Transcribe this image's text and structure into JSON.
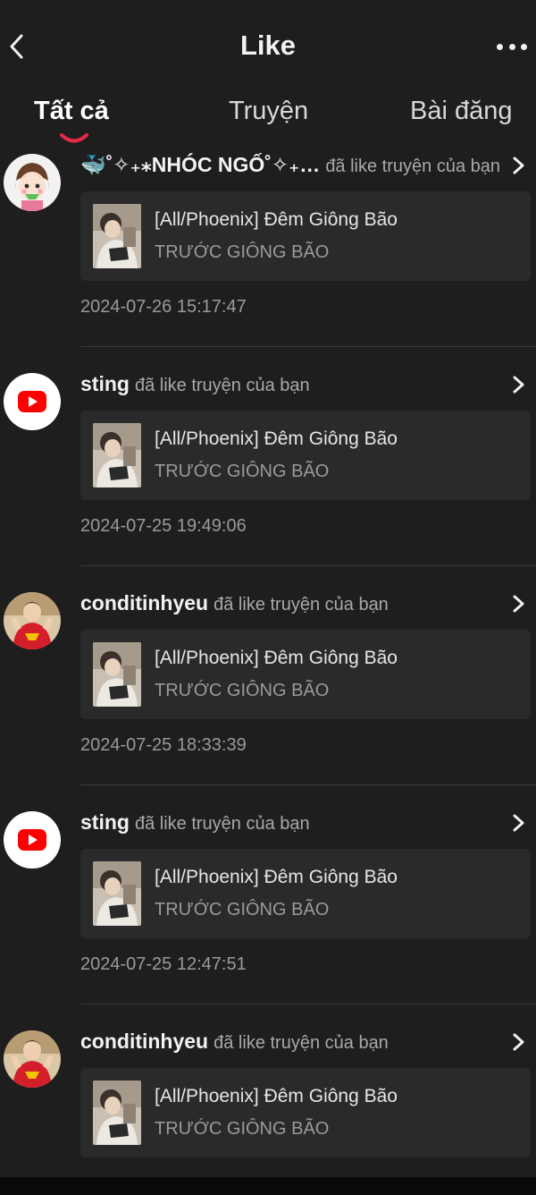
{
  "header": {
    "title": "Like",
    "back_icon": "chevron-left-icon",
    "more_icon": "more-horizontal-icon"
  },
  "tabs": [
    {
      "label": "Tất cả",
      "active": true
    },
    {
      "label": "Truyện",
      "active": false
    },
    {
      "label": "Bài đăng",
      "active": false
    }
  ],
  "colors": {
    "background": "#1e1e1e",
    "card": "#2a2a2a",
    "accent": "#e8294a",
    "youtube_red": "#ff0000"
  },
  "feed": [
    {
      "user": "🐳˚✧₊⁎NHÓC NGỐ˚✧₊…",
      "action": "đã like truyện của bạn",
      "avatar": "cartoon-girl-avatar",
      "story_title": "[All/Phoenix] Đêm Giông Bão",
      "story_subtitle": "TRƯỚC GIÔNG BÃO",
      "time": "2024-07-26 15:17:47"
    },
    {
      "user": "sting",
      "action": "đã like truyện của bạn",
      "avatar": "youtube-logo-avatar",
      "story_title": "[All/Phoenix] Đêm Giông Bão",
      "story_subtitle": "TRƯỚC GIÔNG BÃO",
      "time": "2024-07-25 19:49:06"
    },
    {
      "user": "conditinhyeu",
      "action": "đã like truyện của bạn",
      "avatar": "red-shirt-person-avatar",
      "story_title": "[All/Phoenix] Đêm Giông Bão",
      "story_subtitle": "TRƯỚC GIÔNG BÃO",
      "time": "2024-07-25 18:33:39"
    },
    {
      "user": "sting",
      "action": "đã like truyện của bạn",
      "avatar": "youtube-logo-avatar",
      "story_title": "[All/Phoenix] Đêm Giông Bão",
      "story_subtitle": "TRƯỚC GIÔNG BÃO",
      "time": "2024-07-25 12:47:51"
    },
    {
      "user": "conditinhyeu",
      "action": "đã like truyện của bạn",
      "avatar": "red-shirt-person-avatar",
      "story_title": "[All/Phoenix] Đêm Giông Bão",
      "story_subtitle": "TRƯỚC GIÔNG BÃO",
      "time": ""
    }
  ]
}
